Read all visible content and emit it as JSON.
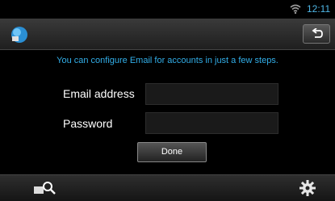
{
  "status": {
    "time": "12:11",
    "wifi_icon": "wifi-icon"
  },
  "titlebar": {
    "app_icon": "email-app-icon",
    "back_icon": "back-arrow-icon"
  },
  "setup": {
    "info_text": "You can configure Email for accounts in just a few steps.",
    "email_label": "Email address",
    "email_value": "",
    "password_label": "Password",
    "password_value": "",
    "done_label": "Done"
  },
  "bottombar": {
    "left_icon": "search-source-icon",
    "right_icon": "settings-gear-icon"
  },
  "colors": {
    "accent": "#32aee8",
    "background": "#000000"
  }
}
